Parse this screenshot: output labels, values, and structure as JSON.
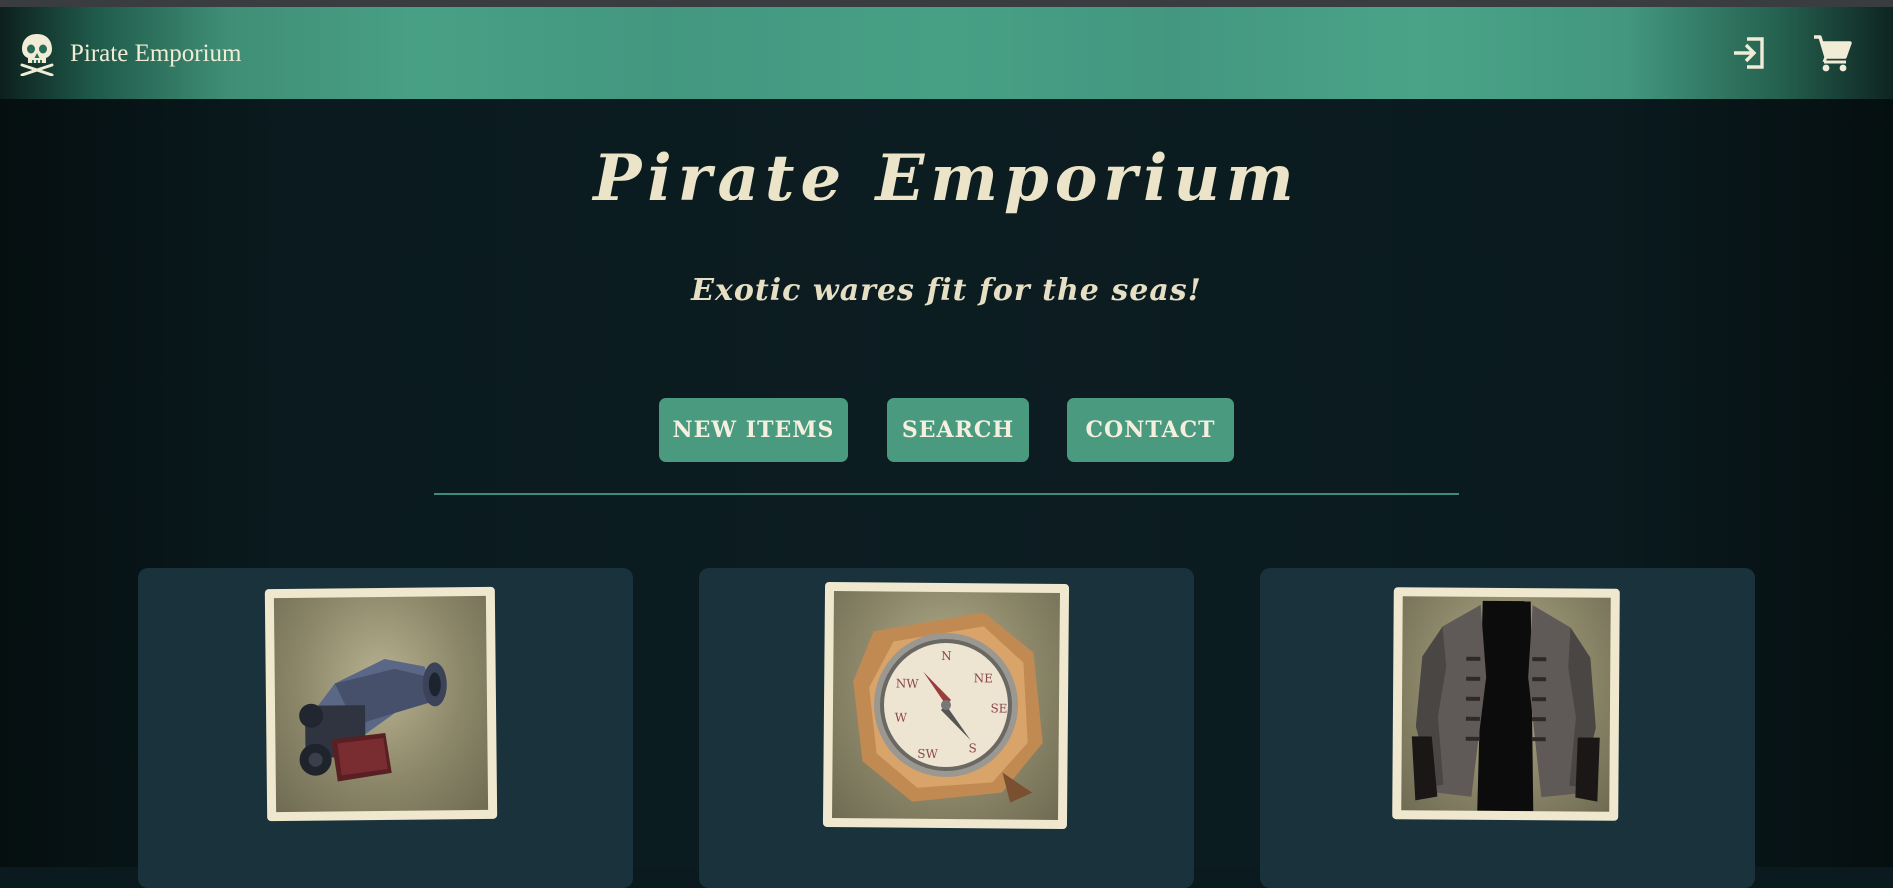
{
  "navbar": {
    "brand_name": "Pirate Emporium",
    "brand_icon": "skull-crossbones-icon",
    "login_icon": "login-icon",
    "cart_icon": "shopping-cart-icon",
    "background_color": "#48a084"
  },
  "hero": {
    "title": "Pirate Emporium",
    "subtitle": "Exotic wares fit for the seas!"
  },
  "nav_buttons": [
    {
      "label": "NEW ITEMS"
    },
    {
      "label": "SEARCH"
    },
    {
      "label": "CONTACT"
    }
  ],
  "products": [
    {
      "image": "cannon-icon"
    },
    {
      "image": "compass-icon"
    },
    {
      "image": "pirate-coat-icon"
    }
  ],
  "colors": {
    "accent": "#4a9a80",
    "page_background": "#0b1a1e",
    "card_background": "#1a323b",
    "text_cream": "#ebe4c8"
  }
}
